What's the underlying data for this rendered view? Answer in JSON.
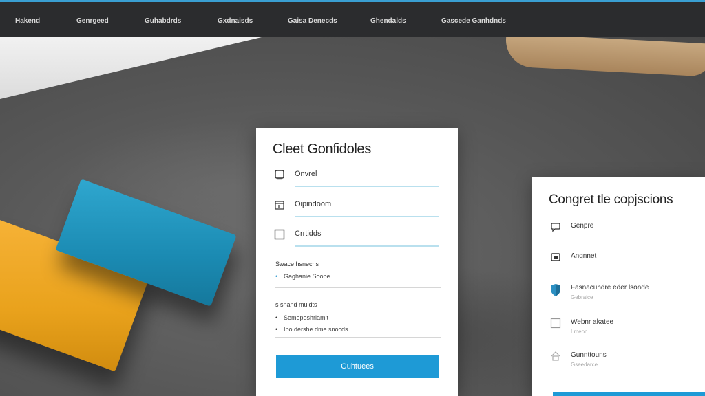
{
  "nav": {
    "items": [
      "Hakend",
      "Genrgeed",
      "Guhabdrds",
      "Gxdnaisds",
      "Gaisa Denecds",
      "Ghendalds",
      "Gascede Ganhdnds"
    ]
  },
  "card1": {
    "title": "Cleet Gonfidoles",
    "fields": [
      {
        "icon": "document-icon",
        "label": "Onvrel"
      },
      {
        "icon": "calendar-icon",
        "label": "Oipindoom"
      },
      {
        "icon": "checkbox-icon",
        "label": "Crrtidds"
      }
    ],
    "section1": {
      "title": "Swace hsnechs",
      "bullets": [
        "Gaghanie Soobe"
      ]
    },
    "section2": {
      "title": "s snand muldts",
      "bullets": [
        "Semeposhriamit",
        "Ibo dershe dme snocds"
      ]
    },
    "button_label": "Guhtuees"
  },
  "card2": {
    "title": "Congret tle copjscions",
    "items": [
      {
        "icon": "chat-icon",
        "label": "Genpre",
        "sub": ""
      },
      {
        "icon": "message-icon",
        "label": "Angnnet",
        "sub": ""
      },
      {
        "icon": "shield-icon",
        "label": "Fasnacuhdre eder lsonde",
        "sub": "Gebraice"
      },
      {
        "icon": "checkbox-icon",
        "label": "Webnr akatee",
        "sub": "Lmeon"
      },
      {
        "icon": "house-icon",
        "label": "Gunnttouns",
        "sub": "Gseedarce"
      }
    ]
  },
  "colors": {
    "accent": "#1e9ad6",
    "topbar": "#2b2c2e",
    "field_line": "#b9e0ee"
  }
}
